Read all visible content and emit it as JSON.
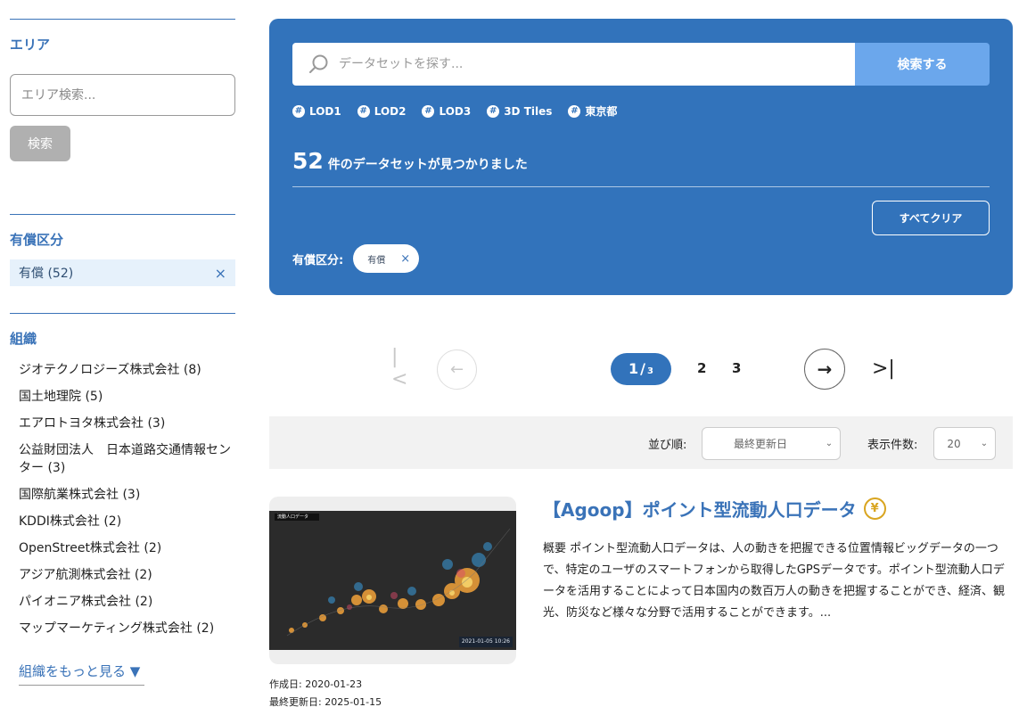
{
  "sidebar": {
    "area": {
      "title": "エリア",
      "input_placeholder": "エリア検索...",
      "search_label": "検索"
    },
    "fee": {
      "title": "有償区分",
      "selected": {
        "label": "有償 (52)",
        "remove": "×"
      }
    },
    "org": {
      "title": "組織",
      "items": [
        {
          "label": "ジオテクノロジーズ株式会社 (8)"
        },
        {
          "label": "国土地理院 (5)"
        },
        {
          "label": "エアロトヨタ株式会社 (3)"
        },
        {
          "label": "公益財団法人　日本道路交通情報センター (3)"
        },
        {
          "label": "国際航業株式会社 (3)"
        },
        {
          "label": "KDDI株式会社 (2)"
        },
        {
          "label": "OpenStreet株式会社 (2)"
        },
        {
          "label": "アジア航測株式会社 (2)"
        },
        {
          "label": "パイオニア株式会社 (2)"
        },
        {
          "label": "マップマーケティング株式会社 (2)"
        }
      ],
      "more_label": "組織をもっと見る ▼"
    }
  },
  "search": {
    "placeholder": "データセットを探す...",
    "button_label": "検索する",
    "icon": "search-icon",
    "tags": [
      {
        "label": "LOD1"
      },
      {
        "label": "LOD2"
      },
      {
        "label": "LOD3"
      },
      {
        "label": "3D Tiles"
      },
      {
        "label": "東京都"
      }
    ],
    "result_count": "52",
    "result_text": "件のデータセットが見つかりました",
    "clear_label": "すべてクリア",
    "filter_label": "有償区分:",
    "filter_chip": {
      "label": "有償",
      "remove": "×"
    }
  },
  "pagination": {
    "first": "|<",
    "prev": "←",
    "current": "1",
    "separator": "/",
    "total": "3",
    "pages": [
      "2",
      "3"
    ],
    "next": "→",
    "last": ">|"
  },
  "sort": {
    "order_label": "並び順:",
    "order_value": "最終更新日",
    "count_label": "表示件数:",
    "count_value": "20"
  },
  "result": {
    "title": "【Agoop】ポイント型流動人口データ",
    "fee_icon": "¥",
    "thumb_badge": "流動人口データ",
    "thumb_stamp": "2021-01-05 10:26",
    "description": "概要 ポイント型流動人口データは、人の動きを把握できる位置情報ビッグデータの一つで、特定のユーザのスマートフォンから取得したGPSデータです。ポイント型流動人口データを活用することによって日本国内の数百万人の動きを把握することができ、経済、観光、防災など様々な分野で活用することができます。...",
    "created": "作成日: 2020-01-23",
    "updated": "最終更新日: 2025-01-15"
  },
  "colors": {
    "brand": "#3273bb",
    "accent_light": "#6ba7ec",
    "fee_icon": "#d9a520"
  }
}
